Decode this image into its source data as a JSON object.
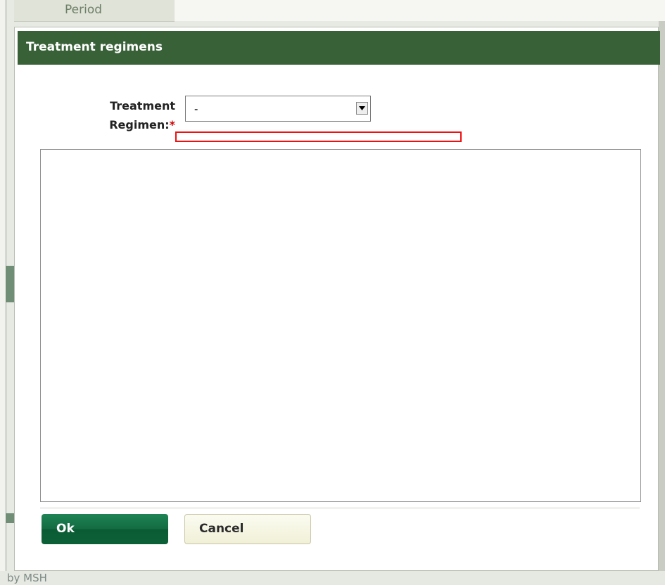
{
  "background": {
    "period_tab_label": "Period",
    "footer_text": "by MSH"
  },
  "dialog": {
    "title": "Treatment regimens",
    "form": {
      "regimen_label_line1": "Treatment",
      "regimen_label_line2": "Regimen:",
      "required_marker": "*",
      "regimen_selected_value": "-",
      "select_icon": "triangle-down-icon"
    },
    "buttons": {
      "ok_label": "Ok",
      "cancel_label": "Cancel"
    }
  },
  "colors": {
    "header_green": "#396138",
    "ok_button_green": "#136c42",
    "cancel_button_cream": "#f1f0d7",
    "required_red": "#cc0000",
    "error_border_red": "#ee1111"
  }
}
